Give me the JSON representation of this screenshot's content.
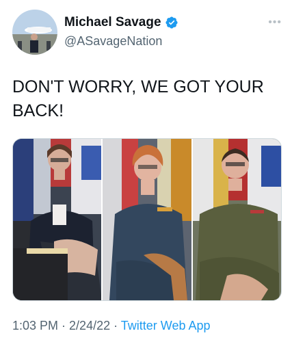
{
  "author": {
    "display_name": "Michael Savage",
    "handle": "@ASavageNation",
    "verified": true,
    "verified_badge_icon": "verified-badge-icon",
    "avatar_icon": "avatar-photo"
  },
  "more_icon": "more-options-icon",
  "tweet": {
    "text": "DON'T WORRY, WE GOT YOUR\nBACK!"
  },
  "media": {
    "photos": [
      "photo-1",
      "photo-2",
      "photo-3"
    ]
  },
  "meta": {
    "time": "1:03 PM",
    "separator": " · ",
    "date": "2/24/22",
    "source": "Twitter Web App"
  },
  "colors": {
    "link": "#1d9bf0",
    "secondary_text": "#536471",
    "primary_text": "#0f1419"
  }
}
